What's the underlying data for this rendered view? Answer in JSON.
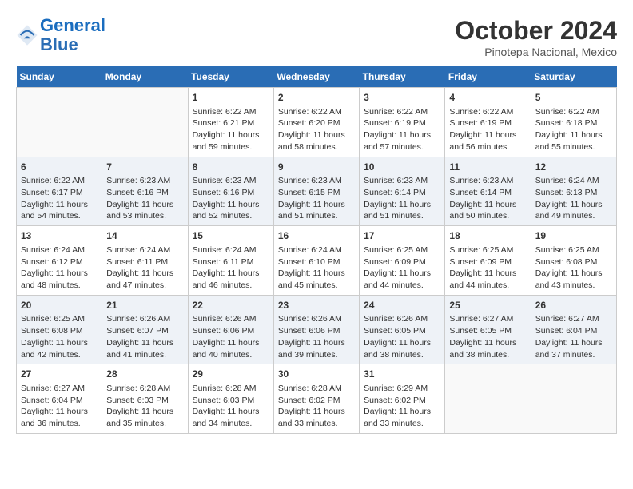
{
  "header": {
    "logo_line1": "General",
    "logo_line2": "Blue",
    "month": "October 2024",
    "location": "Pinotepa Nacional, Mexico"
  },
  "weekdays": [
    "Sunday",
    "Monday",
    "Tuesday",
    "Wednesday",
    "Thursday",
    "Friday",
    "Saturday"
  ],
  "weeks": [
    [
      {
        "day": "",
        "info": ""
      },
      {
        "day": "",
        "info": ""
      },
      {
        "day": "1",
        "info": "Sunrise: 6:22 AM\nSunset: 6:21 PM\nDaylight: 11 hours\nand 59 minutes."
      },
      {
        "day": "2",
        "info": "Sunrise: 6:22 AM\nSunset: 6:20 PM\nDaylight: 11 hours\nand 58 minutes."
      },
      {
        "day": "3",
        "info": "Sunrise: 6:22 AM\nSunset: 6:19 PM\nDaylight: 11 hours\nand 57 minutes."
      },
      {
        "day": "4",
        "info": "Sunrise: 6:22 AM\nSunset: 6:19 PM\nDaylight: 11 hours\nand 56 minutes."
      },
      {
        "day": "5",
        "info": "Sunrise: 6:22 AM\nSunset: 6:18 PM\nDaylight: 11 hours\nand 55 minutes."
      }
    ],
    [
      {
        "day": "6",
        "info": "Sunrise: 6:22 AM\nSunset: 6:17 PM\nDaylight: 11 hours\nand 54 minutes."
      },
      {
        "day": "7",
        "info": "Sunrise: 6:23 AM\nSunset: 6:16 PM\nDaylight: 11 hours\nand 53 minutes."
      },
      {
        "day": "8",
        "info": "Sunrise: 6:23 AM\nSunset: 6:16 PM\nDaylight: 11 hours\nand 52 minutes."
      },
      {
        "day": "9",
        "info": "Sunrise: 6:23 AM\nSunset: 6:15 PM\nDaylight: 11 hours\nand 51 minutes."
      },
      {
        "day": "10",
        "info": "Sunrise: 6:23 AM\nSunset: 6:14 PM\nDaylight: 11 hours\nand 51 minutes."
      },
      {
        "day": "11",
        "info": "Sunrise: 6:23 AM\nSunset: 6:14 PM\nDaylight: 11 hours\nand 50 minutes."
      },
      {
        "day": "12",
        "info": "Sunrise: 6:24 AM\nSunset: 6:13 PM\nDaylight: 11 hours\nand 49 minutes."
      }
    ],
    [
      {
        "day": "13",
        "info": "Sunrise: 6:24 AM\nSunset: 6:12 PM\nDaylight: 11 hours\nand 48 minutes."
      },
      {
        "day": "14",
        "info": "Sunrise: 6:24 AM\nSunset: 6:11 PM\nDaylight: 11 hours\nand 47 minutes."
      },
      {
        "day": "15",
        "info": "Sunrise: 6:24 AM\nSunset: 6:11 PM\nDaylight: 11 hours\nand 46 minutes."
      },
      {
        "day": "16",
        "info": "Sunrise: 6:24 AM\nSunset: 6:10 PM\nDaylight: 11 hours\nand 45 minutes."
      },
      {
        "day": "17",
        "info": "Sunrise: 6:25 AM\nSunset: 6:09 PM\nDaylight: 11 hours\nand 44 minutes."
      },
      {
        "day": "18",
        "info": "Sunrise: 6:25 AM\nSunset: 6:09 PM\nDaylight: 11 hours\nand 44 minutes."
      },
      {
        "day": "19",
        "info": "Sunrise: 6:25 AM\nSunset: 6:08 PM\nDaylight: 11 hours\nand 43 minutes."
      }
    ],
    [
      {
        "day": "20",
        "info": "Sunrise: 6:25 AM\nSunset: 6:08 PM\nDaylight: 11 hours\nand 42 minutes."
      },
      {
        "day": "21",
        "info": "Sunrise: 6:26 AM\nSunset: 6:07 PM\nDaylight: 11 hours\nand 41 minutes."
      },
      {
        "day": "22",
        "info": "Sunrise: 6:26 AM\nSunset: 6:06 PM\nDaylight: 11 hours\nand 40 minutes."
      },
      {
        "day": "23",
        "info": "Sunrise: 6:26 AM\nSunset: 6:06 PM\nDaylight: 11 hours\nand 39 minutes."
      },
      {
        "day": "24",
        "info": "Sunrise: 6:26 AM\nSunset: 6:05 PM\nDaylight: 11 hours\nand 38 minutes."
      },
      {
        "day": "25",
        "info": "Sunrise: 6:27 AM\nSunset: 6:05 PM\nDaylight: 11 hours\nand 38 minutes."
      },
      {
        "day": "26",
        "info": "Sunrise: 6:27 AM\nSunset: 6:04 PM\nDaylight: 11 hours\nand 37 minutes."
      }
    ],
    [
      {
        "day": "27",
        "info": "Sunrise: 6:27 AM\nSunset: 6:04 PM\nDaylight: 11 hours\nand 36 minutes."
      },
      {
        "day": "28",
        "info": "Sunrise: 6:28 AM\nSunset: 6:03 PM\nDaylight: 11 hours\nand 35 minutes."
      },
      {
        "day": "29",
        "info": "Sunrise: 6:28 AM\nSunset: 6:03 PM\nDaylight: 11 hours\nand 34 minutes."
      },
      {
        "day": "30",
        "info": "Sunrise: 6:28 AM\nSunset: 6:02 PM\nDaylight: 11 hours\nand 33 minutes."
      },
      {
        "day": "31",
        "info": "Sunrise: 6:29 AM\nSunset: 6:02 PM\nDaylight: 11 hours\nand 33 minutes."
      },
      {
        "day": "",
        "info": ""
      },
      {
        "day": "",
        "info": ""
      }
    ]
  ]
}
